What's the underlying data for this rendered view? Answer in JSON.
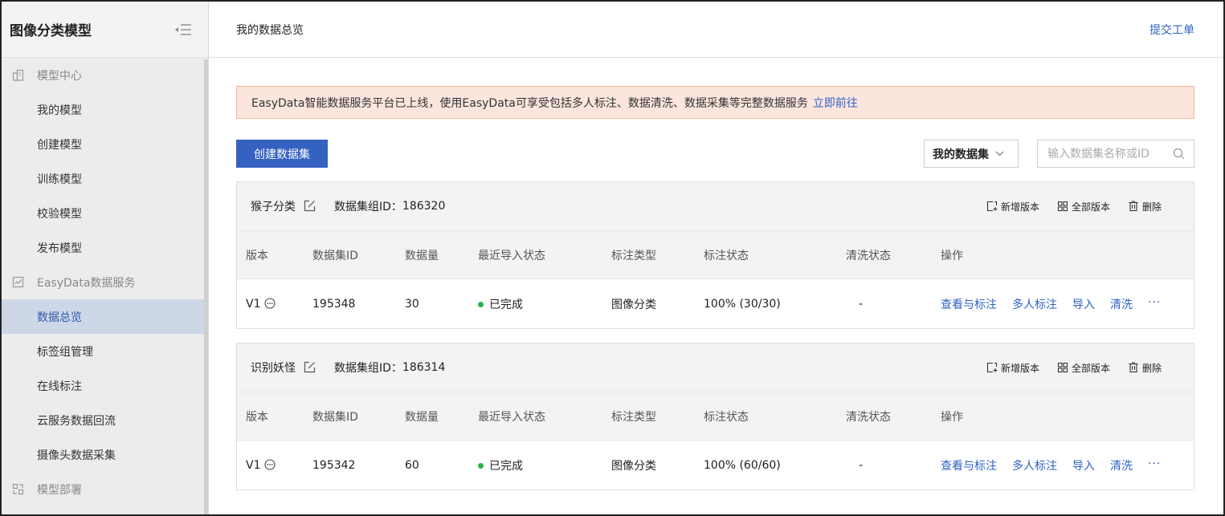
{
  "sidebar": {
    "title": "图像分类模型",
    "groups": [
      {
        "label": "模型中心",
        "icon": "building-icon",
        "items": [
          "我的模型",
          "创建模型",
          "训练模型",
          "校验模型",
          "发布模型"
        ]
      },
      {
        "label": "EasyData数据服务",
        "icon": "chart-icon",
        "items": [
          "数据总览",
          "标签组管理",
          "在线标注",
          "云服务数据回流",
          "摄像头数据采集"
        ]
      },
      {
        "label": "模型部署",
        "icon": "deploy-icon",
        "items": []
      }
    ],
    "active_item": "数据总览"
  },
  "topbar": {
    "breadcrumb": "我的数据总览",
    "ticket_link": "提交工单"
  },
  "notice": {
    "text": "EasyData智能数据服务平台已上线，使用EasyData可享受包括多人标注、数据清洗、数据采集等完整数据服务",
    "link": "立即前往"
  },
  "toolbar": {
    "create_button": "创建数据集",
    "filter_value": "我的数据集",
    "search_placeholder": "输入数据集名称或ID"
  },
  "table_headers": [
    "版本",
    "数据集ID",
    "数据量",
    "最近导入状态",
    "标注类型",
    "标注状态",
    "清洗状态",
    "操作"
  ],
  "card_actions": [
    "新增版本",
    "全部版本",
    "删除"
  ],
  "row_ops": [
    "查看与标注",
    "多人标注",
    "导入",
    "清洗"
  ],
  "datasets": [
    {
      "name": "猴子分类",
      "group_id_label": "数据集组ID：",
      "group_id": "186320",
      "rows": [
        {
          "version": "V1",
          "dataset_id": "195348",
          "count": "30",
          "import_status": "已完成",
          "annotation_type": "图像分类",
          "annotation_status": "100% (30/30)",
          "clean_status": "-"
        }
      ]
    },
    {
      "name": "识别妖怪",
      "group_id_label": "数据集组ID：",
      "group_id": "186314",
      "rows": [
        {
          "version": "V1",
          "dataset_id": "195342",
          "count": "60",
          "import_status": "已完成",
          "annotation_type": "图像分类",
          "annotation_status": "100% (60/60)",
          "clean_status": "-"
        }
      ]
    }
  ],
  "colors": {
    "accent": "#3562c0",
    "link": "#2f62c4",
    "success": "#27b24a",
    "notice_bg": "#fbe5dd"
  }
}
